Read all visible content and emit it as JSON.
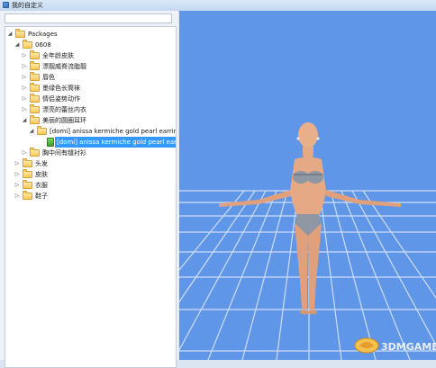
{
  "window": {
    "title": "我的自定义"
  },
  "search": {
    "value": ""
  },
  "tree": {
    "root": "Packages",
    "folder_0608": "0608",
    "items_0608": [
      "全年龄皮肤",
      "漂靓威脊流脂靓",
      "唇色",
      "墨绿色长筒袜",
      "情侣姿势动作",
      "漂亮的蕾丝内衣",
      "美丽的圆圈耳环"
    ],
    "earring_folder": "[domi] anissa kermiche gold pearl earrings",
    "earring_file": "[domi] anissa kermiche gold pearl earrings",
    "after_earrings": "胸中间有缝衬衫",
    "top_level": [
      "头发",
      "皮肤",
      "衣服",
      "鞋子"
    ]
  },
  "watermark": {
    "text": "3DMGAME"
  },
  "colors": {
    "viewport_bg": "#6096e8",
    "selection": "#3399ff"
  }
}
